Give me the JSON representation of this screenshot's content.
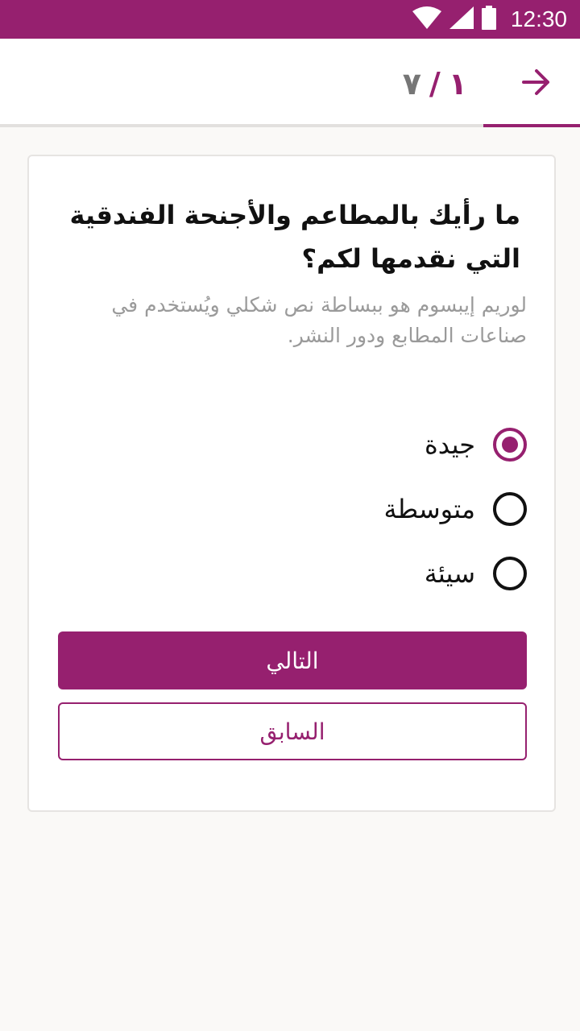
{
  "status_bar": {
    "time": "12:30",
    "icons": [
      "wifi-icon",
      "signal-icon",
      "battery-icon"
    ]
  },
  "header": {
    "back_icon": "arrow-right-icon",
    "step": {
      "current": "١",
      "separator": "/",
      "total": "٧"
    },
    "step_progress": 0.1429,
    "colors": {
      "accent": "#96206f",
      "inactive": "#767676"
    }
  },
  "survey": {
    "question": "ما رأيك بالمطاعم والأجنحة الفندقية التي نقدمها لكم؟",
    "description": "لوريم إيبسوم هو ببساطة نص شكلي ويُستخدم في صناعات المطابع ودور النشر.",
    "options": [
      {
        "label": "جيدة",
        "selected": true
      },
      {
        "label": "متوسطة",
        "selected": false
      },
      {
        "label": "سيئة",
        "selected": false
      }
    ],
    "next_label": "التالي",
    "prev_label": "السابق"
  }
}
